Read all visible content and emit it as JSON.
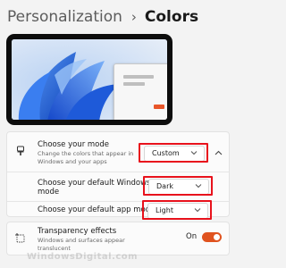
{
  "breadcrumb": {
    "parent": "Personalization",
    "separator": "›",
    "current": "Colors"
  },
  "mode": {
    "label": "Choose your mode",
    "description_line1": "Change the colors that appear in",
    "description_line2": "Windows and your apps",
    "value": "Custom"
  },
  "windows_mode": {
    "label_line1": "Choose your default Windows",
    "label_line2": "mode",
    "value": "Dark"
  },
  "app_mode": {
    "label": "Choose your default app mode",
    "value": "Light"
  },
  "transparency": {
    "label": "Transparency effects",
    "description_line1": "Windows and surfaces appear",
    "description_line2": "translucent",
    "state": "On",
    "on": true
  },
  "watermark": "WindowsDigital.com",
  "colors": {
    "accent": "#e0531f",
    "highlight": "#e8121c",
    "wallpaper_blue": "#1a5cd8"
  },
  "icons": [
    "brush-icon",
    "chevron-down-icon",
    "chevron-up-icon",
    "transparency-icon"
  ]
}
